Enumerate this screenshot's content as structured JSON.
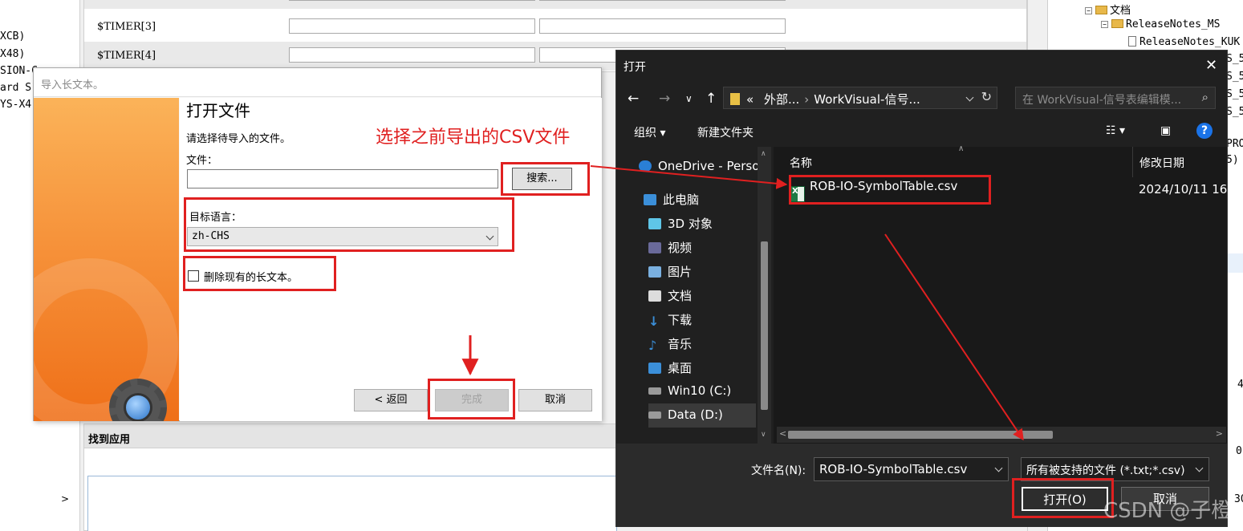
{
  "background": {
    "left_lines": [
      "XCB)",
      "X48)",
      "SION-C",
      "ard S",
      "YS-X4"
    ],
    "timer_rows": [
      "$TIMER[3]",
      "$TIMER[4]"
    ],
    "panel_header": "找到应用",
    "tree": {
      "docs": "文档",
      "release_notes_ms": "ReleaseNotes_MS",
      "release_notes_kuk": "ReleaseNotes_KUK"
    },
    "right_edge": [
      "S_5",
      "S_5",
      "S_5",
      "S_5",
      "PRO",
      "5)",
      "4",
      "0",
      "30"
    ]
  },
  "wizard": {
    "window_title": "导入长文本。",
    "heading": "打开文件",
    "instruction": "请选择待导入的文件。",
    "file_label": "文件：",
    "file_value": "",
    "search_button": "搜索...",
    "target_lang_label": "目标语言：",
    "target_lang_value": "zh-CHS",
    "delete_checkbox_label": "删除现有的长文本。",
    "back_button": "< 返回",
    "finish_button": "完成",
    "cancel_button": "取消"
  },
  "open_dialog": {
    "title": "打开",
    "address": {
      "chevrons": "«",
      "seg1": "外部...",
      "seg2": "WorkVisual-信号..."
    },
    "search_placeholder": "在 WorkVisual-信号表编辑模...",
    "organize": "组织 ▾",
    "new_folder": "新建文件夹",
    "nav_items": [
      {
        "label": "OneDrive - Perso",
        "icon": "onedrive-icon"
      },
      {
        "label": "此电脑",
        "icon": "computer-icon"
      },
      {
        "label": "3D 对象",
        "icon": "3d-objects-icon"
      },
      {
        "label": "视频",
        "icon": "video-icon"
      },
      {
        "label": "图片",
        "icon": "pictures-icon"
      },
      {
        "label": "文档",
        "icon": "documents-icon"
      },
      {
        "label": "下载",
        "icon": "download-icon"
      },
      {
        "label": "音乐",
        "icon": "music-icon"
      },
      {
        "label": "桌面",
        "icon": "desktop-icon"
      },
      {
        "label": "Win10 (C:)",
        "icon": "drive-icon"
      },
      {
        "label": "Data (D:)",
        "icon": "drive-icon"
      }
    ],
    "columns": {
      "name": "名称",
      "modified": "修改日期"
    },
    "file": {
      "name": "ROB-IO-SymbolTable.csv",
      "modified": "2024/10/11 16:"
    },
    "filename_label": "文件名(N):",
    "filename_value": "ROB-IO-SymbolTable.csv",
    "filetype_value": "所有被支持的文件 (*.txt;*.csv)",
    "open_button": "打开(O)",
    "cancel_button": "取消",
    "colors": {
      "bg": "#202020",
      "pane": "#191919",
      "bottom": "#2b2b2b"
    }
  },
  "annotation": {
    "text": "选择之前导出的CSV文件",
    "color": "#e02020"
  },
  "watermark": "CSDN @子橙"
}
